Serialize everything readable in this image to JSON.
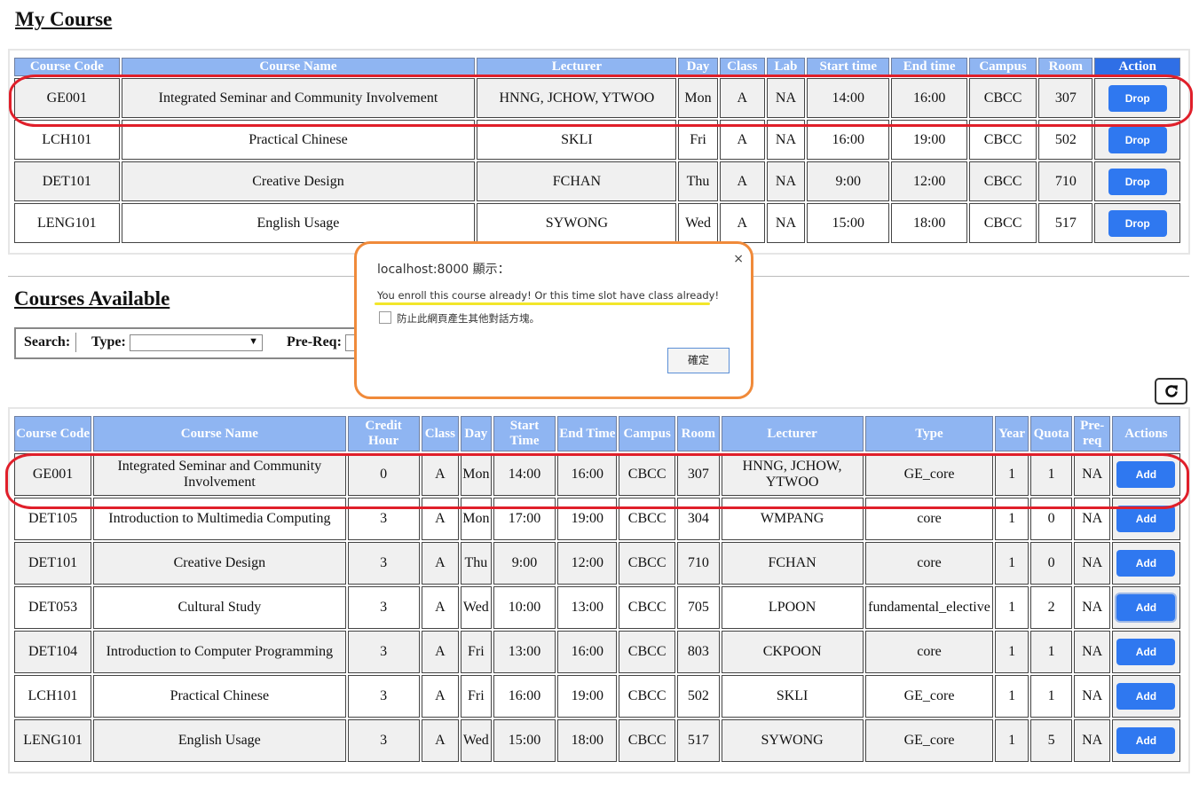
{
  "my_course": {
    "heading": "My Course",
    "headers": [
      "Course Code",
      "Course Name",
      "Lecturer",
      "Day",
      "Class",
      "Lab",
      "Start time",
      "End time",
      "Campus",
      "Room",
      "Action"
    ],
    "rows": [
      {
        "code": "GE001",
        "name": "Integrated Seminar and Community Involvement",
        "lecturer": "HNNG, JCHOW, YTWOO",
        "day": "Mon",
        "class": "A",
        "lab": "NA",
        "start": "14:00",
        "end": "16:00",
        "campus": "CBCC",
        "room": "307",
        "action": "Drop"
      },
      {
        "code": "LCH101",
        "name": "Practical Chinese",
        "lecturer": "SKLI",
        "day": "Fri",
        "class": "A",
        "lab": "NA",
        "start": "16:00",
        "end": "19:00",
        "campus": "CBCC",
        "room": "502",
        "action": "Drop"
      },
      {
        "code": "DET101",
        "name": "Creative Design",
        "lecturer": "FCHAN",
        "day": "Thu",
        "class": "A",
        "lab": "NA",
        "start": "9:00",
        "end": "12:00",
        "campus": "CBCC",
        "room": "710",
        "action": "Drop"
      },
      {
        "code": "LENG101",
        "name": "English Usage",
        "lecturer": "SYWONG",
        "day": "Wed",
        "class": "A",
        "lab": "NA",
        "start": "15:00",
        "end": "18:00",
        "campus": "CBCC",
        "room": "517",
        "action": "Drop"
      }
    ]
  },
  "available": {
    "heading": "Courses Available ",
    "search_label": "Search:",
    "type_label": "Type:",
    "type_value": "",
    "prereq_label": "Pre-Req:",
    "headers": [
      "Course Code",
      "Course Name",
      "Credit Hour",
      "Class",
      "Day",
      "Start Time",
      "End Time",
      "Campus",
      "Room",
      "Lecturer",
      "Type",
      "Year",
      "Quota",
      "Pre-req",
      "Actions"
    ],
    "rows": [
      {
        "code": "GE001",
        "name": "Integrated Seminar and Community Involvement",
        "credit": "0",
        "class": "A",
        "day": "Mon",
        "start": "14:00",
        "end": "16:00",
        "campus": "CBCC",
        "room": "307",
        "lecturer": "HNNG, JCHOW, YTWOO",
        "type": "GE_core",
        "year": "1",
        "quota": "1",
        "prereq": "NA",
        "action": "Add"
      },
      {
        "code": "DET105",
        "name": "Introduction to Multimedia Computing",
        "credit": "3",
        "class": "A",
        "day": "Mon",
        "start": "17:00",
        "end": "19:00",
        "campus": "CBCC",
        "room": "304",
        "lecturer": "WMPANG",
        "type": "core",
        "year": "1",
        "quota": "0",
        "prereq": "NA",
        "action": "Add"
      },
      {
        "code": "DET101",
        "name": "Creative Design",
        "credit": "3",
        "class": "A",
        "day": "Thu",
        "start": "9:00",
        "end": "12:00",
        "campus": "CBCC",
        "room": "710",
        "lecturer": "FCHAN",
        "type": "core",
        "year": "1",
        "quota": "0",
        "prereq": "NA",
        "action": "Add"
      },
      {
        "code": "DET053",
        "name": "Cultural Study",
        "credit": "3",
        "class": "A",
        "day": "Wed",
        "start": "10:00",
        "end": "13:00",
        "campus": "CBCC",
        "room": "705",
        "lecturer": "LPOON",
        "type": "fundamental_elective",
        "year": "1",
        "quota": "2",
        "prereq": "NA",
        "action": "Add"
      },
      {
        "code": "DET104",
        "name": "Introduction to Computer Programming",
        "credit": "3",
        "class": "A",
        "day": "Fri",
        "start": "13:00",
        "end": "16:00",
        "campus": "CBCC",
        "room": "803",
        "lecturer": "CKPOON",
        "type": "core",
        "year": "1",
        "quota": "1",
        "prereq": "NA",
        "action": "Add"
      },
      {
        "code": "LCH101",
        "name": "Practical Chinese",
        "credit": "3",
        "class": "A",
        "day": "Fri",
        "start": "16:00",
        "end": "19:00",
        "campus": "CBCC",
        "room": "502",
        "lecturer": "SKLI",
        "type": "GE_core",
        "year": "1",
        "quota": "1",
        "prereq": "NA",
        "action": "Add"
      },
      {
        "code": "LENG101",
        "name": "English Usage",
        "credit": "3",
        "class": "A",
        "day": "Wed",
        "start": "15:00",
        "end": "18:00",
        "campus": "CBCC",
        "room": "517",
        "lecturer": "SYWONG",
        "type": "GE_core",
        "year": "1",
        "quota": "5",
        "prereq": "NA",
        "action": "Add"
      }
    ]
  },
  "dialog": {
    "title": "localhost:8000 顯示：",
    "message": "You enroll this course already! Or this time slot have class already!",
    "checkbox_label": "防止此網頁產生其他對話方塊。",
    "ok_label": "確定",
    "close_glyph": "×"
  },
  "colors": {
    "header_blue": "#8fb5f2",
    "button_blue": "#2f78f0",
    "highlight_red": "#e01f2a",
    "dialog_orange": "#f08a3a",
    "underline_yellow": "#f2e62a"
  },
  "icons": {
    "refresh": "refresh-icon"
  }
}
